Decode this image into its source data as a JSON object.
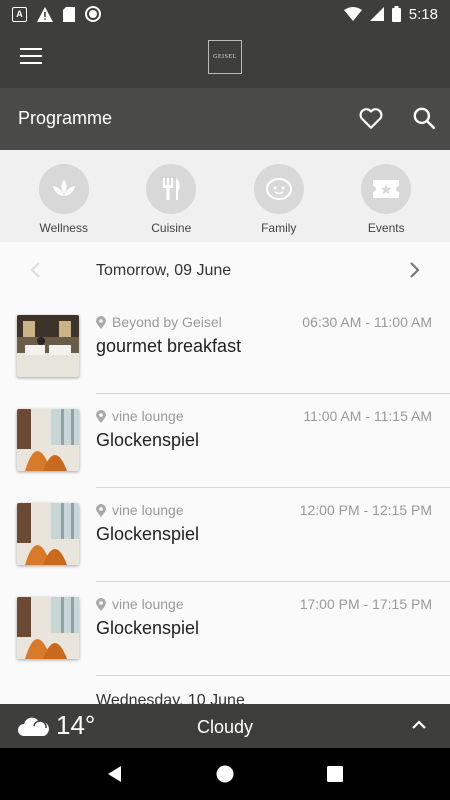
{
  "status_bar": {
    "time": "5:18",
    "left_icons": [
      "a-icon",
      "warning-icon",
      "sd-card-icon",
      "record-icon"
    ],
    "right_icons": [
      "wifi-icon",
      "signal-icon",
      "battery-icon"
    ]
  },
  "app_bar": {
    "logo_text": "GEISEL"
  },
  "toolbar": {
    "title": "Programme"
  },
  "categories": [
    {
      "label": "Wellness",
      "icon": "lotus-icon"
    },
    {
      "label": "Cuisine",
      "icon": "cutlery-icon"
    },
    {
      "label": "Family",
      "icon": "child-face-icon"
    },
    {
      "label": "Events",
      "icon": "ticket-icon"
    }
  ],
  "date_nav": {
    "current": "Tomorrow, 09 June"
  },
  "programme": [
    {
      "location": "Beyond by Geisel",
      "time": "06:30 AM - 11:00 AM",
      "title": "gourmet breakfast"
    },
    {
      "location": "vine lounge",
      "time": "11:00 AM - 11:15 AM",
      "title": "Glockenspiel"
    },
    {
      "location": "vine lounge",
      "time": "12:00 PM - 12:15 PM",
      "title": "Glockenspiel"
    },
    {
      "location": "vine lounge",
      "time": "17:00 PM - 17:15 PM",
      "title": "Glockenspiel"
    }
  ],
  "next_day_header": "Wednesday, 10 June",
  "weather": {
    "temperature": "14°",
    "condition": "Cloudy"
  },
  "colors": {
    "dark_bar": "#3e3f3c",
    "toolbar": "#4a4b48",
    "category_bg": "#f0f0f0"
  }
}
